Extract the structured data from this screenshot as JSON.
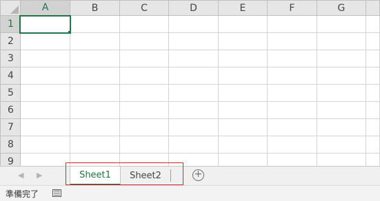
{
  "sheet": {
    "columns": [
      "A",
      "B",
      "C",
      "D",
      "E",
      "F",
      "G"
    ],
    "rows": [
      "1",
      "2",
      "3",
      "4",
      "5",
      "6",
      "7",
      "8",
      "9"
    ],
    "active_cell": "A1"
  },
  "tabs": {
    "items": [
      {
        "label": "Sheet1",
        "active": true
      },
      {
        "label": "Sheet2",
        "active": false
      }
    ],
    "nav_prev": "◀",
    "nav_next": "▶",
    "add_label": "+"
  },
  "status": {
    "text": "準備完了"
  },
  "colors": {
    "accent": "#217346",
    "highlight": "#d9232c"
  }
}
